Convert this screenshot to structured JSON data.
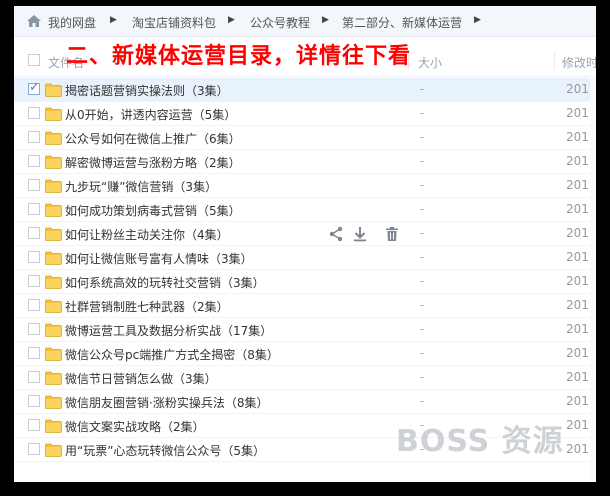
{
  "breadcrumb": {
    "items": [
      "我的网盘",
      "淘宝店铺资料包",
      "公众号教程",
      "第二部分、新媒体运营"
    ]
  },
  "header": {
    "name_label": "文件名",
    "size_label": "大小",
    "date_label": "修改时"
  },
  "overlay_title": "二、新媒体运营目录，详情往下看",
  "rows": [
    {
      "name": "揭密话题营销实操法则（3集）",
      "size": "-",
      "date": "2017",
      "selected": true
    },
    {
      "name": "从0开始，讲透内容运营（5集）",
      "size": "-",
      "date": "2017"
    },
    {
      "name": "公众号如何在微信上推广（6集）",
      "size": "-",
      "date": "2017"
    },
    {
      "name": "解密微博运营与涨粉方略（2集）",
      "size": "-",
      "date": "2017"
    },
    {
      "name": "九步玩“赚”微信营销（3集）",
      "size": "-",
      "date": "2017"
    },
    {
      "name": "如何成功策划病毒式营销（5集）",
      "size": "-",
      "date": "2017"
    },
    {
      "name": "如何让粉丝主动关注你（4集）",
      "size": "-",
      "date": "2017",
      "hover": true
    },
    {
      "name": "如何让微信账号富有人情味（3集）",
      "size": "-",
      "date": "2017"
    },
    {
      "name": "如何系统高效的玩转社交营销（3集）",
      "size": "-",
      "date": "2017"
    },
    {
      "name": "社群营销制胜七种武器（2集）",
      "size": "-",
      "date": "2017"
    },
    {
      "name": "微博运营工具及数据分析实战（17集）",
      "size": "-",
      "date": "2017"
    },
    {
      "name": "微信公众号pc端推广方式全揭密（8集）",
      "size": "-",
      "date": "2017"
    },
    {
      "name": "微信节日营销怎么做（3集）",
      "size": "-",
      "date": "2017"
    },
    {
      "name": "微信朋友圈营销·涨粉实操兵法（8集）",
      "size": "-",
      "date": "2017"
    },
    {
      "name": "微信文案实战攻略（2集）",
      "size": "-",
      "date": "2017"
    },
    {
      "name": "用“玩票”心态玩转微信公众号（5集）",
      "size": "-",
      "date": "2017"
    }
  ],
  "row_actions": [
    "share-icon",
    "download-icon",
    "delete-icon"
  ],
  "watermark": "BOSS 资源",
  "colors": {
    "accent": "#3b7fd6",
    "title_red": "#ff0000",
    "folder": "#f5c342"
  }
}
